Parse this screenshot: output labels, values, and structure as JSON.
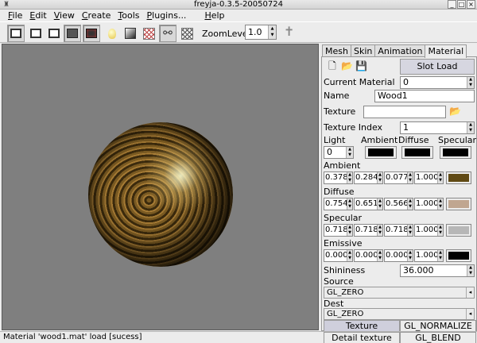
{
  "window": {
    "title": "freyja-0.3.5-20050724",
    "controls": [
      "_",
      "□",
      "×"
    ]
  },
  "menu": [
    {
      "underline": "F",
      "rest": "ile"
    },
    {
      "underline": "E",
      "rest": "dit"
    },
    {
      "underline": "V",
      "rest": "iew"
    },
    {
      "underline": "C",
      "rest": "reate"
    },
    {
      "underline": "T",
      "rest": "ools"
    },
    {
      "underline": "P",
      "rest": "lugins..."
    },
    {
      "underline": "H",
      "rest": "elp"
    }
  ],
  "toolbar": {
    "zoom_label": "ZoomLevel",
    "zoom_value": "1.0"
  },
  "tabs": [
    "Mesh",
    "Skin",
    "Animation",
    "Material"
  ],
  "material": {
    "slot_load": "Slot Load",
    "current_material_label": "Current Material",
    "current_material_value": "0",
    "name_label": "Name",
    "name_value": "Wood1",
    "texture_label": "Texture",
    "texture_value": "",
    "texture_index_label": "Texture Index",
    "texture_index_value": "1",
    "light_label": "Light",
    "light_value": "0",
    "ambient_hdr": "Ambient",
    "diffuse_hdr": "Diffuse",
    "specular_hdr": "Specular",
    "ambient": {
      "label": "Ambient",
      "values": [
        "0.378",
        "0.284",
        "0.077",
        "1.000"
      ],
      "color": "#604a14"
    },
    "diffuse": {
      "label": "Diffuse",
      "values": [
        "0.754",
        "0.651",
        "0.566",
        "1.000"
      ],
      "color": "#c0a690"
    },
    "specular": {
      "label": "Specular",
      "values": [
        "0.718",
        "0.718",
        "0.718",
        "1.000"
      ],
      "color": "#b7b7b7"
    },
    "emissive": {
      "label": "Emissive",
      "values": [
        "0.000",
        "0.000",
        "0.000",
        "1.000"
      ],
      "color": "#000000"
    },
    "shininess_label": "Shininess",
    "shininess_value": "36.000",
    "source_label": "Source",
    "source_value": "GL_ZERO",
    "dest_label": "Dest",
    "dest_value": "GL_ZERO",
    "btn_texture": "Texture",
    "btn_normalize": "GL_NORMALIZE",
    "btn_detail": "Detail texture",
    "btn_blend": "GL_BLEND"
  },
  "status": "Material 'wood1.mat' load [sucess]"
}
